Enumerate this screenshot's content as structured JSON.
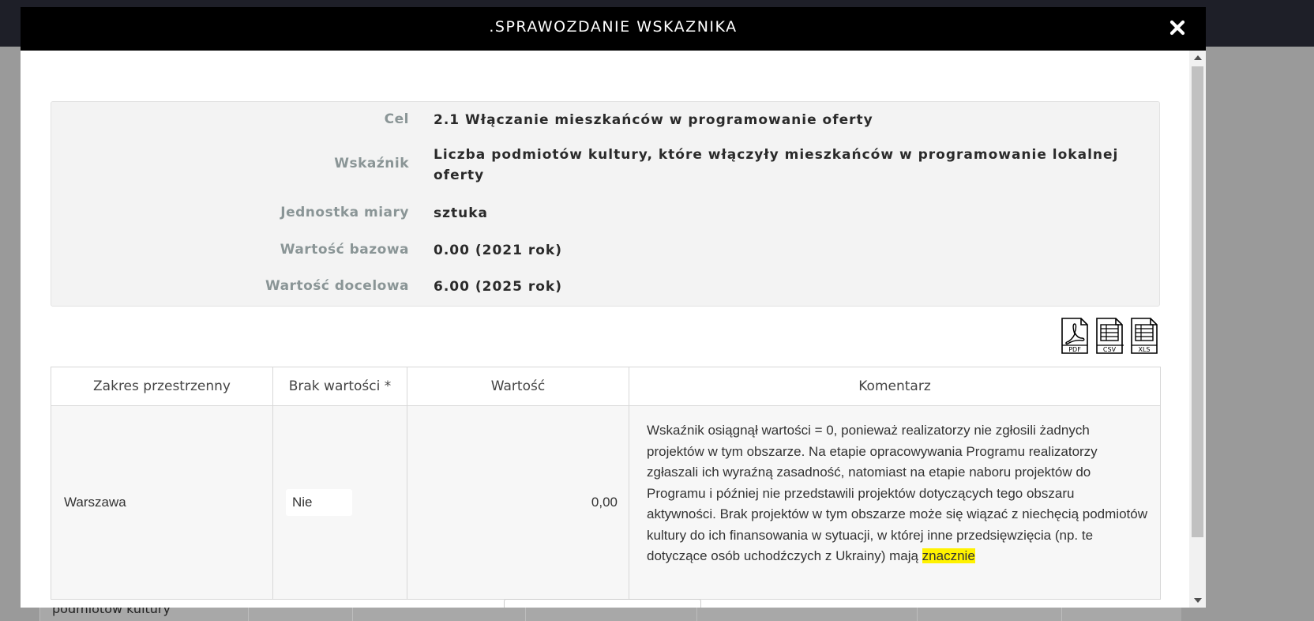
{
  "background": {
    "row_first_cell": "podmiotów kultury"
  },
  "modal": {
    "title": ".SPRAWOZDANIE WSKAZNIKA",
    "close_icon": "close-icon"
  },
  "info": {
    "cel_label": "Cel",
    "cel_value": "2.1 Włączanie mieszkańców w programowanie oferty",
    "wskaznik_label": "Wskaźnik",
    "wskaznik_value": "Liczba podmiotów kultury, które włączyły mieszkańców w programowanie lokalnej oferty",
    "jednostka_label": "Jednostka miary",
    "jednostka_value": "sztuka",
    "bazowa_label": "Wartość bazowa",
    "bazowa_value": "0.00 (2021 rok)",
    "docelowa_label": "Wartość docelowa",
    "docelowa_value": "6.00 (2025 rok)"
  },
  "exports": {
    "pdf": "PDF",
    "csv": "CSV",
    "xls": "XLS"
  },
  "table": {
    "headers": [
      "Zakres przestrzenny",
      "Brak wartości *",
      "Wartość",
      "Komentarz"
    ],
    "row": {
      "zakres": "Warszawa",
      "brak": "Nie",
      "wartosc": "0,00",
      "komentarz": "Wskaźnik osiągnął wartości = 0, ponieważ realizatorzy nie zgłosili żadnych projektów w tym obszarze. Na etapie opracowywania Programu realizatorzy zgłaszali ich wyraźną zasadność, natomiast na etapie naboru projektów do Programu i później nie przedstawili projektów dotyczących tego obszaru aktywności. Brak projektów w tym obszarze może się wiązać z niechęcią podmiotów kultury do ich finansowania w sytuacji, w której inne przedsięwzięcia (np. te dotyczące osób uchodźczych z Ukrainy) mają",
      "komentarz_highlight": "znacznie"
    }
  },
  "colors": {
    "header_bg": "#000000",
    "highlight": "#fff200",
    "label_color": "#8a9596"
  }
}
